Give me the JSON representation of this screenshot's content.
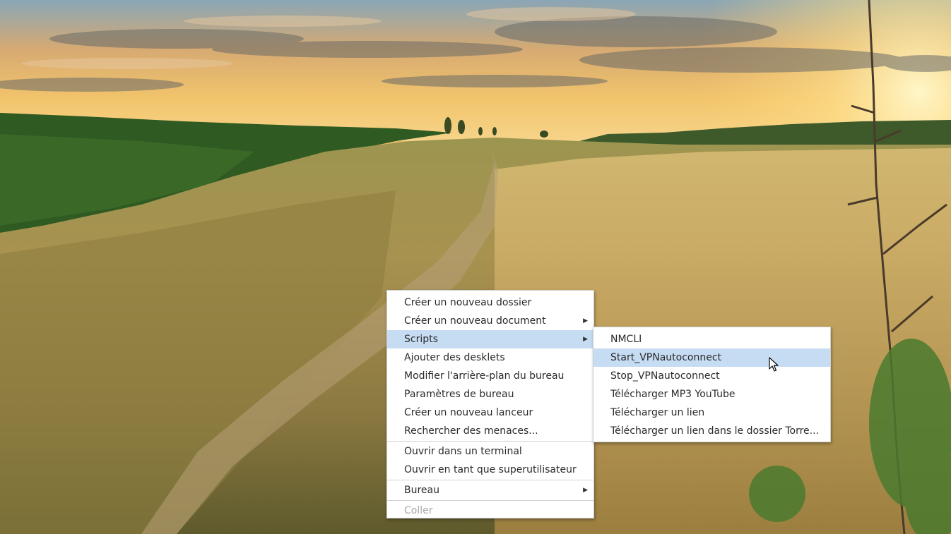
{
  "desktop": {
    "context_menu": {
      "items": [
        {
          "label": "Créer un nouveau dossier"
        },
        {
          "label": "Créer un nouveau document"
        },
        {
          "label": "Scripts"
        },
        {
          "label": "Ajouter des desklets"
        },
        {
          "label": "Modifier l'arrière-plan du bureau"
        },
        {
          "label": "Paramètres de bureau"
        },
        {
          "label": "Créer un nouveau lanceur"
        },
        {
          "label": "Rechercher des menaces..."
        },
        {
          "label": "Ouvrir dans un terminal"
        },
        {
          "label": "Ouvrir en tant que superutilisateur"
        },
        {
          "label": "Bureau"
        },
        {
          "label": "Coller"
        }
      ]
    },
    "scripts_submenu": {
      "items": [
        {
          "label": "NMCLI"
        },
        {
          "label": "Start_VPNautoconnect"
        },
        {
          "label": "Stop_VPNautoconnect"
        },
        {
          "label": "Télécharger MP3 YouTube"
        },
        {
          "label": "Télécharger un lien"
        },
        {
          "label": "Télécharger un lien dans le dossier Torre..."
        }
      ]
    },
    "icons": {
      "submenu_arrow": "chevron-right-icon",
      "cursor": "mouse-pointer-icon"
    },
    "colors": {
      "menu_background": "#ffffff",
      "highlight": "#c6dcf3",
      "disabled_text": "#a8a8a8"
    }
  }
}
